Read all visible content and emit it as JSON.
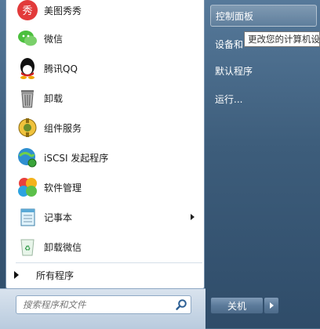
{
  "programs": [
    {
      "label": "美图秀秀",
      "icon": "meitu-icon"
    },
    {
      "label": "微信",
      "icon": "wechat-icon"
    },
    {
      "label": "腾讯QQ",
      "icon": "qq-icon"
    },
    {
      "label": "卸载",
      "icon": "trash-icon"
    },
    {
      "label": "组件服务",
      "icon": "component-services-icon"
    },
    {
      "label": "iSCSI 发起程序",
      "icon": "iscsi-globe-icon"
    },
    {
      "label": "软件管理",
      "icon": "software-manager-icon"
    },
    {
      "label": "记事本",
      "icon": "notepad-icon"
    },
    {
      "label": "卸载微信",
      "icon": "recycle-bin-icon"
    }
  ],
  "all_programs_label": "所有程序",
  "search": {
    "placeholder": "搜索程序和文件"
  },
  "right_items": [
    {
      "label": "控制面板"
    },
    {
      "label": "设备和"
    },
    {
      "label": "默认程序"
    },
    {
      "label": "运行..."
    }
  ],
  "tooltip": "更改您的计算机设",
  "shutdown_label": "关机",
  "colors": {
    "accent": "#3d5d7b",
    "highlight": "#ffffff"
  }
}
